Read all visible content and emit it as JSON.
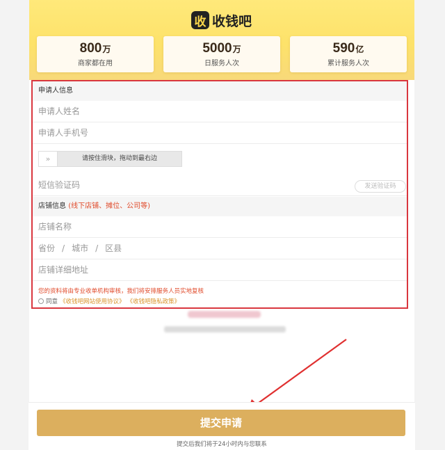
{
  "brand": {
    "logo_char": "收",
    "name": "收钱吧"
  },
  "stats": [
    {
      "number": "800",
      "unit": "万",
      "label": "商家都在用"
    },
    {
      "number": "5000",
      "unit": "万",
      "label": "日服务人次"
    },
    {
      "number": "590",
      "unit": "亿",
      "label": "累计服务人次"
    }
  ],
  "applicant": {
    "title": "申请人信息",
    "name_placeholder": "申请人姓名",
    "phone_placeholder": "申请人手机号",
    "slider_handle": "»",
    "slider_text": "请按住滑块，拖动到最右边",
    "sms_placeholder": "短信验证码",
    "sms_button": "发送验证码"
  },
  "store": {
    "title": "店铺信息",
    "note": "(线下店铺、摊位、公司等)",
    "name_placeholder": "店铺名称",
    "province": "省份",
    "city": "城市",
    "district": "区县",
    "separator": "/",
    "address_placeholder": "店铺详细地址"
  },
  "notice": "您的资料将由专业收单机构审核，我们将安排服务人员实地复核",
  "agreement": {
    "prefix": "同意",
    "terms_link": "《收钱吧网站使用协议》",
    "privacy_link": "《收钱吧隐私政策》"
  },
  "submit": {
    "label": "提交申请",
    "note": "提交后我们将于24小时内与您联系"
  },
  "colors": {
    "accent_red": "#d9363e",
    "button_gold": "#dcaf5e",
    "hero_yellow": "#fde26a",
    "link_orange": "#d9932a"
  }
}
